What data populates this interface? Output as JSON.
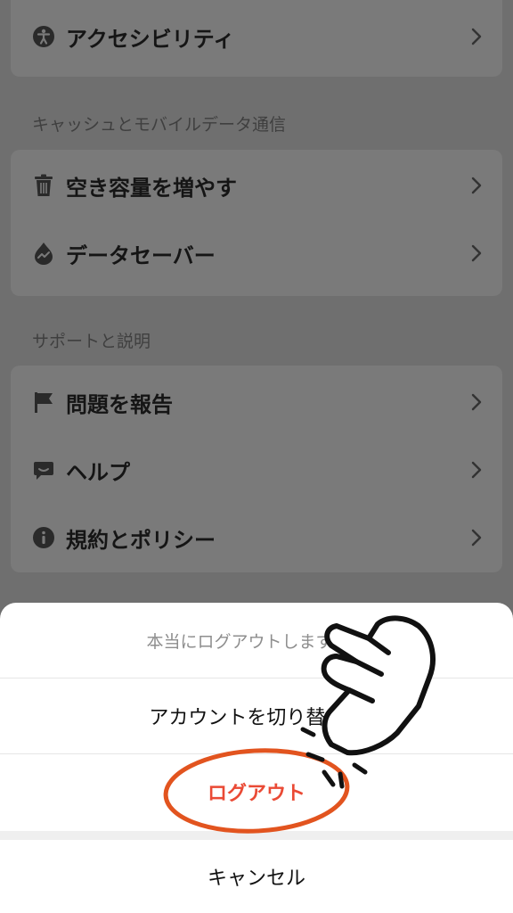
{
  "rows": {
    "accessibility": "アクセシビリティ",
    "free_space": "空き容量を増やす",
    "data_saver": "データセーバー",
    "report_problem": "問題を報告",
    "help": "ヘルプ",
    "terms_policy": "規約とポリシー"
  },
  "sections": {
    "cache_data": "キャッシュとモバイルデータ通信",
    "support": "サポートと説明"
  },
  "sheet": {
    "prompt": "本当にログアウトしますか？",
    "switch_account": "アカウントを切り替える",
    "logout": "ログアウト",
    "cancel": "キャンセル"
  },
  "colors": {
    "danger": "#ea4a35",
    "highlight_circle": "#e2541f"
  },
  "icons": [
    "accessibility-icon",
    "trash-icon",
    "data-saver-icon",
    "flag-icon",
    "help-icon",
    "info-icon",
    "chevron-right-icon",
    "pointing-hand-icon"
  ]
}
